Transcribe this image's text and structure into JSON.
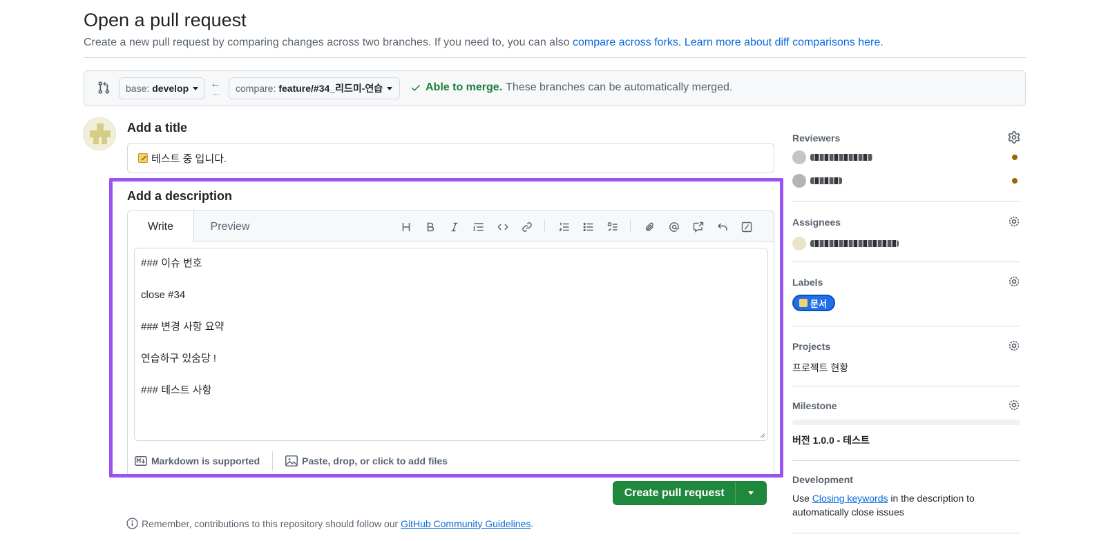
{
  "header": {
    "title": "Open a pull request",
    "subtitle_prefix": "Create a new pull request by comparing changes across two branches. If you need to, you can also ",
    "compare_forks_link": "compare across forks.",
    "learn_more_link": "Learn more about diff comparisons here."
  },
  "compare_bar": {
    "base_prefix": "base:",
    "base_branch": "develop",
    "compare_prefix": "compare:",
    "compare_branch": "feature/#34_리드미-연습",
    "merge_ok": "Able to merge.",
    "merge_text": "These branches can be automatically merged."
  },
  "title_section": {
    "label": "Add a title",
    "value": "테스트 중 입니다."
  },
  "description": {
    "label": "Add a description",
    "tabs": [
      "Write",
      "Preview"
    ],
    "lines": [
      "### 이슈 번호",
      "",
      "close #34",
      "",
      "### 변경 사항 요약",
      "",
      "연습하구 있숨당 !",
      "",
      "### 테스트 사항"
    ],
    "markdown_note": "Markdown is supported",
    "attach_note": "Paste, drop, or click to add files"
  },
  "actions": {
    "create_label": "Create pull request"
  },
  "guidelines": {
    "prefix": "Remember, contributions to this repository should follow our ",
    "link": "GitHub Community Guidelines",
    "suffix": "."
  },
  "sidebar": {
    "reviewers": {
      "heading": "Reviewers"
    },
    "assignees": {
      "heading": "Assignees"
    },
    "labels": {
      "heading": "Labels",
      "items": [
        "문서"
      ]
    },
    "projects": {
      "heading": "Projects",
      "value": "프로젝트 현황"
    },
    "milestone": {
      "heading": "Milestone",
      "value": "버전 1.0.0 - 테스트"
    },
    "development": {
      "heading": "Development",
      "prefix": "Use ",
      "link": "Closing keywords",
      "suffix": " in the description to automatically close issues"
    }
  },
  "colors": {
    "highlight": "#9b52f2",
    "primary_button": "#1f883d",
    "link": "#0969da",
    "success": "#1a7f37",
    "label_pill": "#1f6feb"
  },
  "icons": {
    "toolbar": [
      "heading-icon",
      "bold-icon",
      "italic-icon",
      "quote-icon",
      "code-icon",
      "link-icon",
      "ordered-list-icon",
      "unordered-list-icon",
      "task-list-icon",
      "attach-icon",
      "mention-icon",
      "cross-reference-icon",
      "undo-icon",
      "slash-command-icon"
    ]
  }
}
